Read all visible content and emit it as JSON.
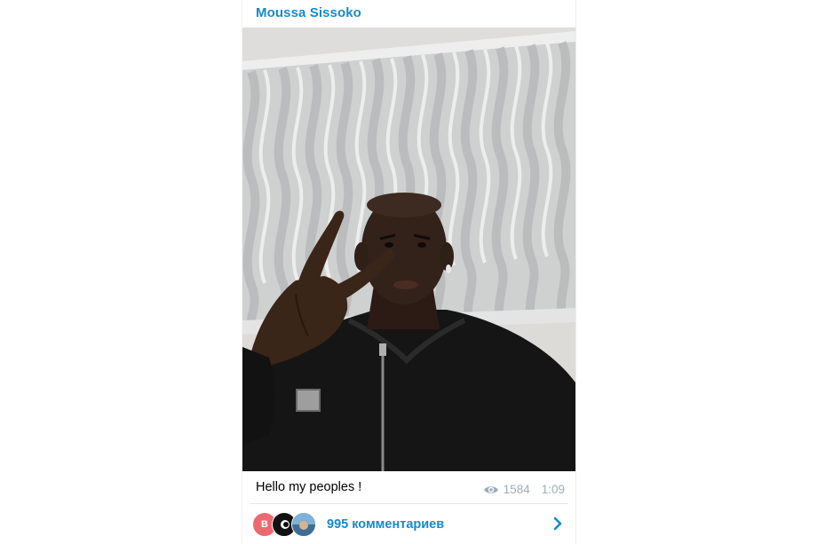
{
  "post": {
    "channel_name": "Moussa Sissoko",
    "caption": "Hello my peoples !",
    "views": "1584",
    "time": "1:09"
  },
  "comments": {
    "count_label": "995 комментариев",
    "avatars": [
      {
        "initial": "B",
        "color": "#ec6a6f"
      },
      {
        "initial": "",
        "color": "#111111"
      },
      {
        "initial": "",
        "color": "#5b8fb8"
      }
    ]
  },
  "icons": {
    "views": "eye-icon",
    "open_comments": "chevron-right-icon"
  },
  "colors": {
    "accent": "#168acd",
    "meta_text": "#a0acb6"
  }
}
